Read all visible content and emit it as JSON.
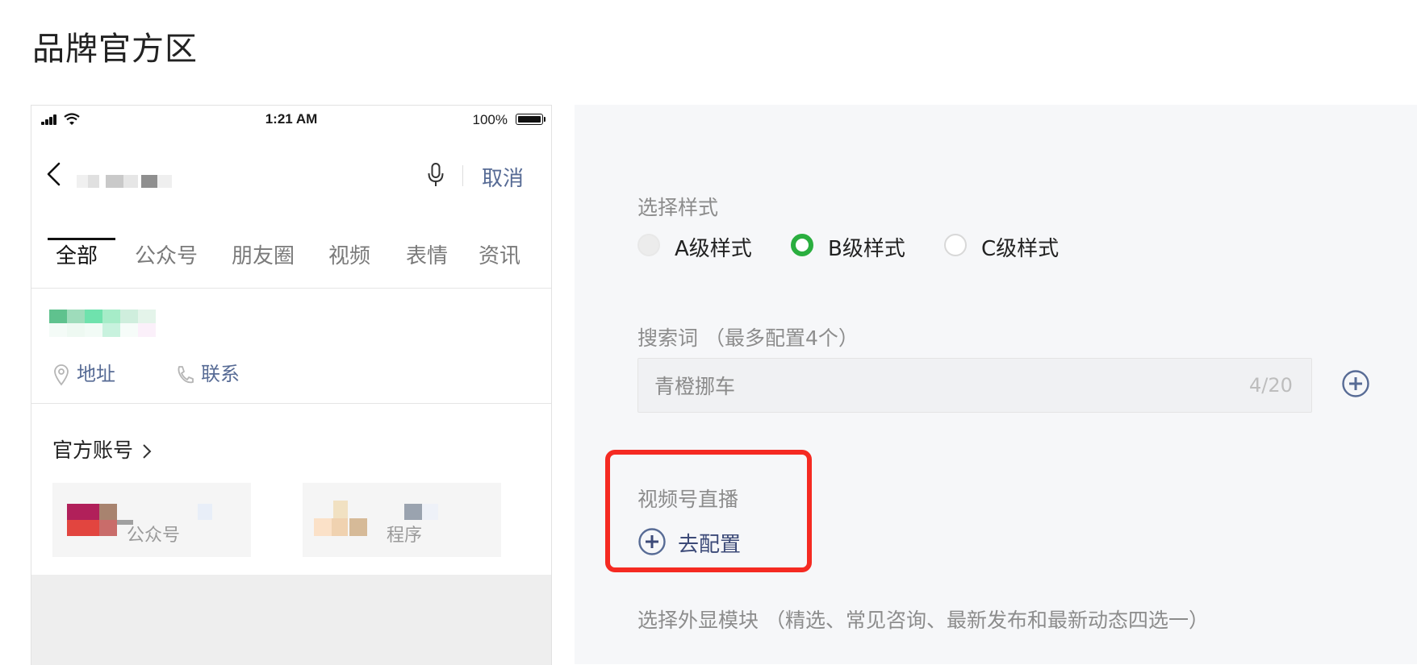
{
  "page": {
    "title": "品牌官方区"
  },
  "phone": {
    "status_bar": {
      "time": "1:21 AM",
      "battery": "100%"
    },
    "search": {
      "cancel_label": "取消"
    },
    "tabs": [
      {
        "label": "全部",
        "active": true
      },
      {
        "label": "公众号",
        "active": false
      },
      {
        "label": "朋友圈",
        "active": false
      },
      {
        "label": "视频",
        "active": false
      },
      {
        "label": "表情",
        "active": false
      },
      {
        "label": "资讯",
        "active": false
      }
    ],
    "brand_card": {
      "address_label": "地址",
      "contact_label": "联系"
    },
    "official_accounts": {
      "title": "官方账号",
      "items": [
        {
          "label": "公众号"
        },
        {
          "label": "程序"
        }
      ]
    }
  },
  "config": {
    "style_label": "选择样式",
    "style_options": [
      {
        "label": "A级样式",
        "state": "disabled"
      },
      {
        "label": "B级样式",
        "state": "checked"
      },
      {
        "label": "C级样式",
        "state": "unchecked"
      }
    ],
    "search_terms_label": "搜索词 （最多配置4个）",
    "search_term": {
      "value": "青橙挪车",
      "count": "4/20"
    },
    "live_label": "视频号直播",
    "live_button_label": "去配置",
    "module_label": "选择外显模块 （精选、常见咨询、最新发布和最新动态四选一）",
    "colors": {
      "accent_green": "#2aae3f",
      "link_blue": "#576b95",
      "highlight_red": "#f52a22"
    }
  }
}
